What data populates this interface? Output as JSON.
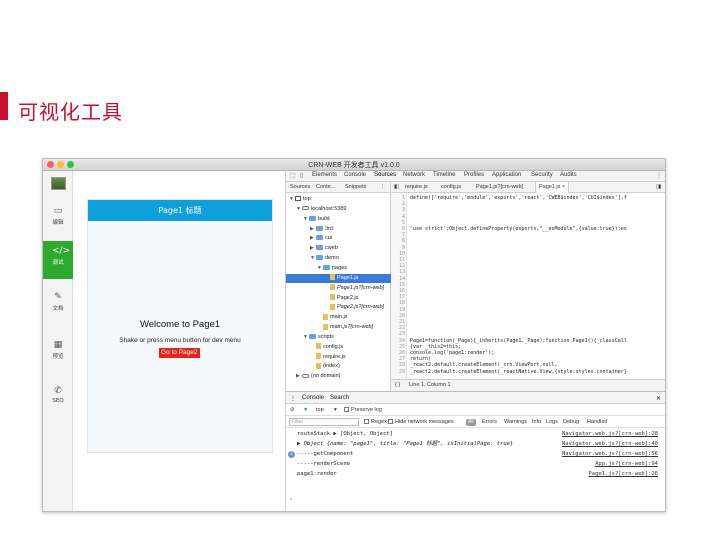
{
  "slide": {
    "title": "可视化工具",
    "accent": "#c8102e"
  },
  "window": {
    "title": "CRN-WEB 开发者工具 v1.0.0"
  },
  "sidebar": {
    "items": [
      {
        "label": "编辑",
        "icon": "edit-icon"
      },
      {
        "label": "调试",
        "icon": "code-icon",
        "active": true
      },
      {
        "label": "文档",
        "icon": "document-icon"
      },
      {
        "label": "预览",
        "icon": "qr-code-icon"
      },
      {
        "label": "SEO",
        "icon": "seo-icon"
      }
    ]
  },
  "phone": {
    "header": "Page1 标题",
    "welcome": "Welcome to Page1",
    "hint": "Shake or press menu button for dev menu",
    "link": "Go to Page2",
    "header_color": "#0fa0dc",
    "link_color": "#e8231b"
  },
  "devtools": {
    "tabs": [
      "Elements",
      "Console",
      "Sources",
      "Network",
      "Timeline",
      "Profiles",
      "Application",
      "Security",
      "Audits"
    ],
    "nav_tabs": [
      "Sources",
      "Conte...",
      "Snippets"
    ],
    "tree": [
      {
        "label": "top",
        "kind": "frame",
        "depth": 0
      },
      {
        "label": "localhost:5389",
        "kind": "cloud",
        "depth": 1
      },
      {
        "label": "build",
        "kind": "folder",
        "depth": 2
      },
      {
        "label": "3rd",
        "kind": "folder",
        "depth": 3
      },
      {
        "label": "cui",
        "kind": "folder",
        "depth": 3
      },
      {
        "label": "cweb",
        "kind": "folder",
        "depth": 3
      },
      {
        "label": "demo",
        "kind": "folder",
        "depth": 3
      },
      {
        "label": "pages",
        "kind": "folder",
        "depth": 4
      },
      {
        "label": "Page1.js",
        "kind": "file",
        "depth": 5,
        "selected": true
      },
      {
        "label": "Page1.js?[crn-web]",
        "kind": "file",
        "depth": 5,
        "italic": true
      },
      {
        "label": "Page2.js",
        "kind": "file",
        "depth": 5
      },
      {
        "label": "Page2.js?[crn-web]",
        "kind": "file",
        "depth": 5,
        "italic": true
      },
      {
        "label": "main.js",
        "kind": "file",
        "depth": 4
      },
      {
        "label": "main.js?[crn-web]",
        "kind": "file",
        "depth": 4,
        "italic": true
      },
      {
        "label": "scripts",
        "kind": "folder",
        "depth": 2
      },
      {
        "label": "config.js",
        "kind": "file",
        "depth": 3
      },
      {
        "label": "require.js",
        "kind": "file",
        "depth": 3
      },
      {
        "label": "(index)",
        "kind": "file",
        "depth": 3
      },
      {
        "label": "(no domain)",
        "kind": "cloud",
        "depth": 1
      }
    ],
    "file_tabs": [
      "require.js",
      "config.js",
      "Page1.js?[crn-web]",
      "Page1.js ×"
    ],
    "code": {
      "line_numbers": [
        "1",
        "2",
        "3",
        "4",
        "5",
        "6",
        "7",
        "8",
        "9",
        "10",
        "11",
        "12",
        "13",
        "14",
        "15",
        "16",
        "17",
        "18",
        "19",
        "20",
        "21",
        "22",
        "23",
        "24",
        "25",
        "26",
        "27",
        "28",
        "29"
      ],
      "lines": [
        "define(['require','module','exports','react','CWEB$index','CUI$index'],f",
        "",
        "",
        "",
        "",
        "'use strict';Object.defineProperty(exports,\"__esModule\",{value:true});ex",
        "",
        "",
        "",
        "",
        "",
        "",
        "",
        "",
        "",
        "",
        "",
        "",
        "",
        "",
        "",
        "",
        "",
        "Page1=function(_Page){_inherits(Page1,_Page);function Page1(){_classCall",
        "{var _this2=this;",
        "console.log('page1:render');",
        "return(",
        "_react2.default.createElement(_crn.ViewPort,null,",
        "_react2.default.createElement(_reactNative.View,{style:styles.container}"
      ]
    },
    "status": "Line 1, Column 1",
    "console": {
      "tabs": [
        "Console",
        "Search"
      ],
      "context": "top",
      "preserve_log": "Preserve log",
      "filter_placeholder": "Filter",
      "regex": "Regex",
      "hide_network": "Hide network messages",
      "levels": [
        "All",
        "Errors",
        "Warnings",
        "Info",
        "Logs",
        "Debug",
        "Handled"
      ],
      "logs": [
        {
          "text": "routeStack ▶ [Object, Object]",
          "source": "Navigator.web.js?[crn-web]:28"
        },
        {
          "text": "▶ Object {name: \"page1\", title: \"Page1 标题\", isInitialPage: true}",
          "source": "Navigator.web.js?[crn-web]:40"
        },
        {
          "text": "-----getComponent",
          "source": "Navigator.web.js?[crn-web]:56",
          "badge": "2"
        },
        {
          "text": "-----renderScene",
          "source": "App.js?[crn-web]:94"
        },
        {
          "text": "page1:render",
          "source": "Page1.js?[crn-web]:26"
        }
      ],
      "prompt": "›"
    }
  }
}
